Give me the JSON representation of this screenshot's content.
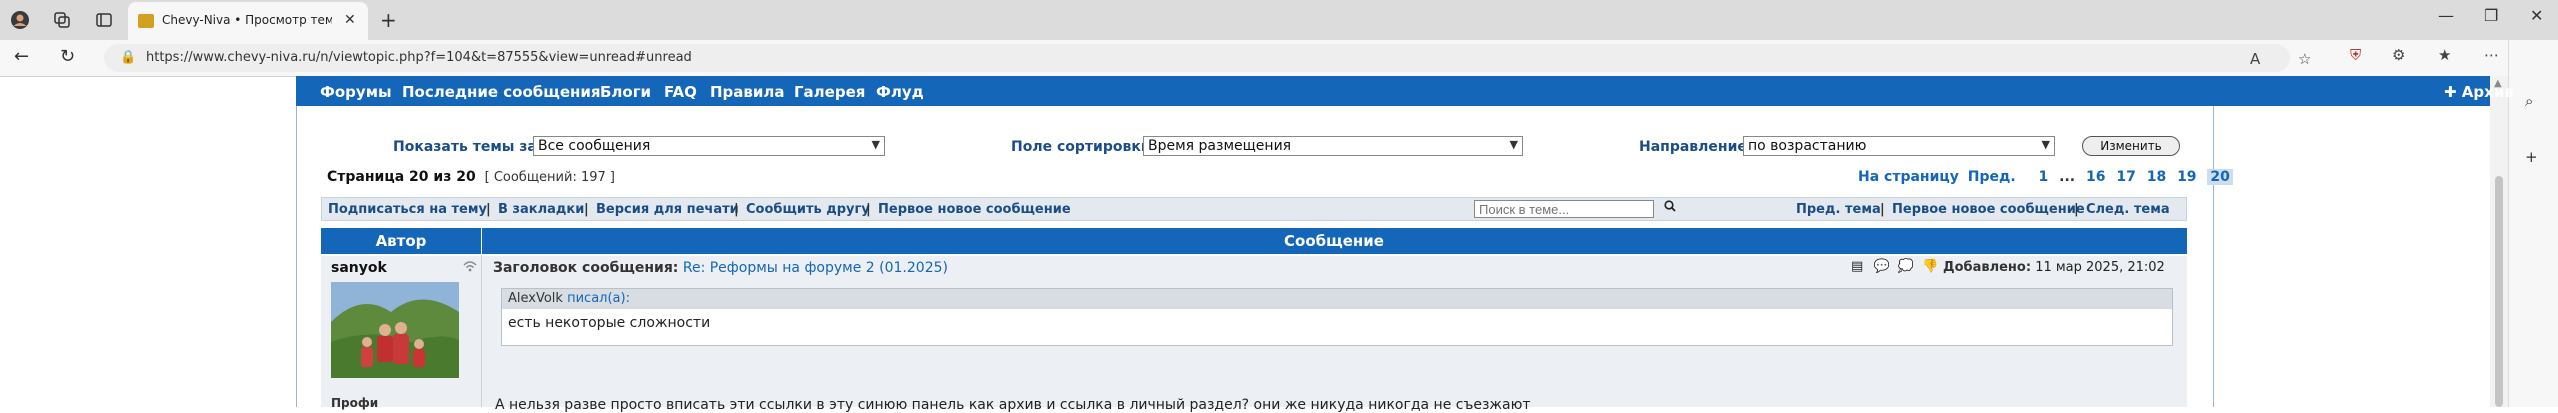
{
  "browser": {
    "tab_title": "Chevy-Niva • Просмотр темы - Р",
    "url": "https://www.chevy-niva.ru/n/viewtopic.php?f=104&t=87555&view=unread#unread"
  },
  "nav": {
    "items": [
      "Форумы",
      "Последние сообщения",
      "Блоги",
      "FAQ",
      "Правила",
      "Галерея",
      "Флуд"
    ],
    "archive": "Архив"
  },
  "filters": {
    "show_label": "Показать темы за:",
    "show_value": "Все сообщения",
    "sort_label": "Поле сортировки",
    "sort_value": "Время размещения",
    "dir_label": "Направление",
    "dir_value": "по возрастанию",
    "change_button": "Изменить"
  },
  "pagination": {
    "page_label": "Страница 20 из 20",
    "message_count": "[ Сообщений: 197 ]",
    "goto_label": "На страницу",
    "prev": "Пред.",
    "first": "1",
    "ellipsis": "...",
    "pages": [
      "16",
      "17",
      "18",
      "19"
    ],
    "current": "20"
  },
  "toolbar": {
    "subscribe": "Подписаться на тему",
    "bookmark": "В закладки",
    "print": "Версия для печати",
    "tell_friend": "Сообщить другу",
    "first_new": "Первое новое сообщение",
    "search_placeholder": "Поиск в теме...",
    "prev_topic": "Пред. тема",
    "first_new_right": "Первое новое сообщение",
    "next_topic": "След. тема",
    "sep": "|"
  },
  "table": {
    "author_header": "Автор",
    "message_header": "Сообщение"
  },
  "post": {
    "author": "sanyok",
    "rank": "Профи",
    "subject_label": "Заголовок сообщения:",
    "subject": "Re: Реформы на форуме 2 (01.2025)",
    "date_label": "Добавлено:",
    "date": "11 мар 2025, 21:02",
    "quote_author": "AlexVolk",
    "quote_wrote": "писал(а):",
    "quote_text": "есть некоторые сложности",
    "body": "А нельзя разве просто вписать эти ссылки в эту синюю панель как архив и ссылка в личный раздел? они же никуда никогда не съезжают"
  }
}
